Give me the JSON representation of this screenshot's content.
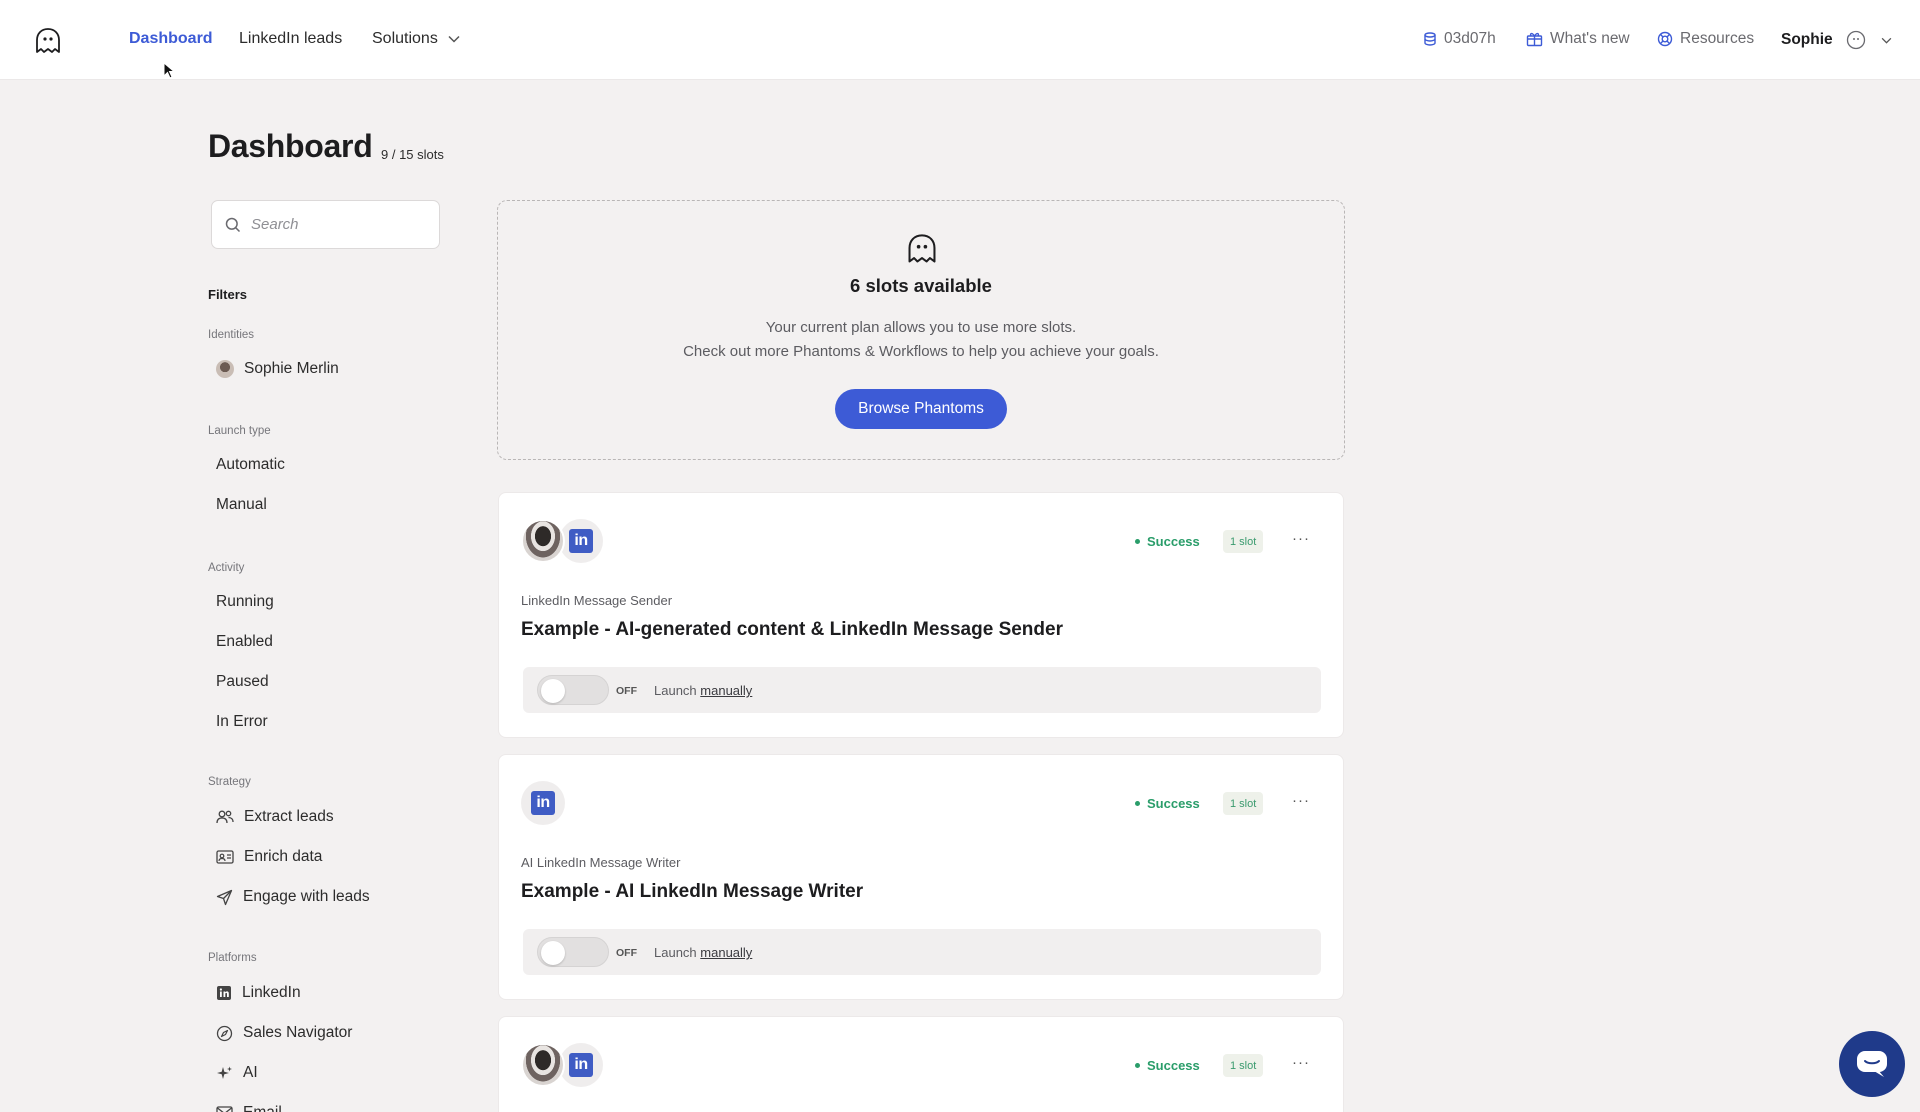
{
  "nav": {
    "links": [
      "Dashboard",
      "LinkedIn leads",
      "Solutions"
    ],
    "timer": "03d07h",
    "whats_new": "What's new",
    "resources": "Resources",
    "user": "Sophie"
  },
  "page": {
    "title": "Dashboard",
    "slots": "9 / 15 slots"
  },
  "sidebar": {
    "search_placeholder": "Search",
    "filters_title": "Filters",
    "groups": {
      "identities": {
        "label": "Identities",
        "items": [
          "Sophie Merlin"
        ]
      },
      "launch_type": {
        "label": "Launch type",
        "items": [
          "Automatic",
          "Manual"
        ]
      },
      "activity": {
        "label": "Activity",
        "items": [
          "Running",
          "Enabled",
          "Paused",
          "In Error"
        ]
      },
      "strategy": {
        "label": "Strategy",
        "items": [
          "Extract leads",
          "Enrich data",
          "Engage with leads"
        ]
      },
      "platforms": {
        "label": "Platforms",
        "items": [
          "LinkedIn",
          "Sales Navigator",
          "AI",
          "Email"
        ]
      }
    }
  },
  "slots_card": {
    "title": "6 slots available",
    "line1": "Your current plan allows you to use more slots.",
    "line2": "Check out more Phantoms & Workflows to help you achieve your goals.",
    "button": "Browse Phantoms"
  },
  "phantoms": [
    {
      "type": "LinkedIn Message Sender",
      "name": "Example - AI-generated content & LinkedIn Message Sender",
      "status": "Success",
      "slot": "1 slot",
      "toggle": "OFF",
      "launch_prefix": "Launch",
      "launch_mode": "manually"
    },
    {
      "type": "AI LinkedIn Message Writer",
      "name": "Example - AI LinkedIn Message Writer",
      "status": "Success",
      "slot": "1 slot",
      "toggle": "OFF",
      "launch_prefix": "Launch",
      "launch_mode": "manually"
    },
    {
      "status": "Success",
      "slot": "1 slot"
    }
  ],
  "icons": {
    "linkedin_glyph": "in",
    "more": "···"
  },
  "colors": {
    "accent": "#3d5bd6",
    "success": "#2a9d6a",
    "linkedin": "#3f5cc4",
    "chat": "#1f3a8a"
  }
}
